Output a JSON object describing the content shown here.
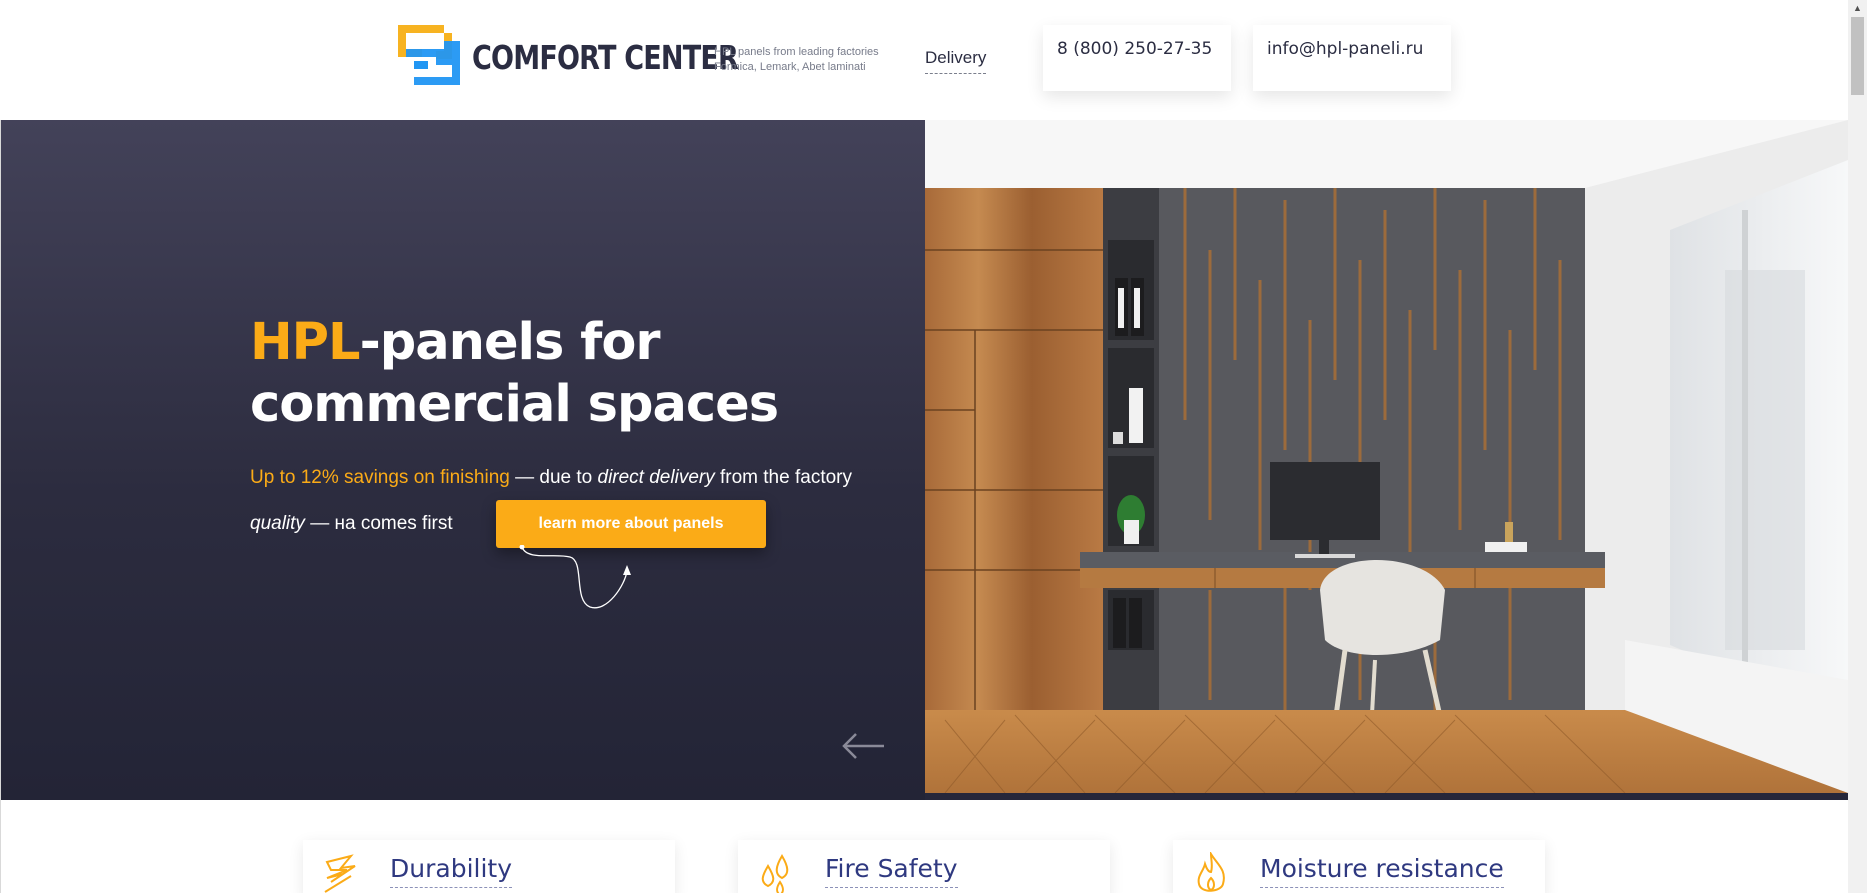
{
  "header": {
    "brand": "COMFORT CENTER",
    "tagline_line1": "HPL panels from leading factories",
    "tagline_line2": "Formica, Lemark, Abet laminati",
    "nav_delivery": "Delivery",
    "phone": "8 (800) 250-27-35",
    "email": "info@hpl-paneli.ru"
  },
  "hero": {
    "title_accent": "HPL",
    "title_rest": "-panels for commercial spaces",
    "sub1_highlight": "Up to 12% savings on finishing",
    "sub1_mid": " — due to ",
    "sub1_italic": "direct delivery",
    "sub1_end": " from the factory",
    "sub2_italic": "quality",
    "sub2_rest": " — на comes first",
    "cta_label": "learn more about panels",
    "prev_icon": "arrow-left-icon",
    "next_icon": "arrow-right-icon"
  },
  "features": [
    {
      "title": "Durability",
      "icon": "lightning-icon"
    },
    {
      "title": "Fire Safety",
      "icon": "drops-icon"
    },
    {
      "title": "Moisture resistance",
      "icon": "flame-icon"
    }
  ],
  "colors": {
    "accent": "#fbab17",
    "dark": "#2b2d42",
    "feature_title": "#2f3980",
    "logo_yellow": "#f7b321",
    "logo_blue": "#2196f3"
  }
}
